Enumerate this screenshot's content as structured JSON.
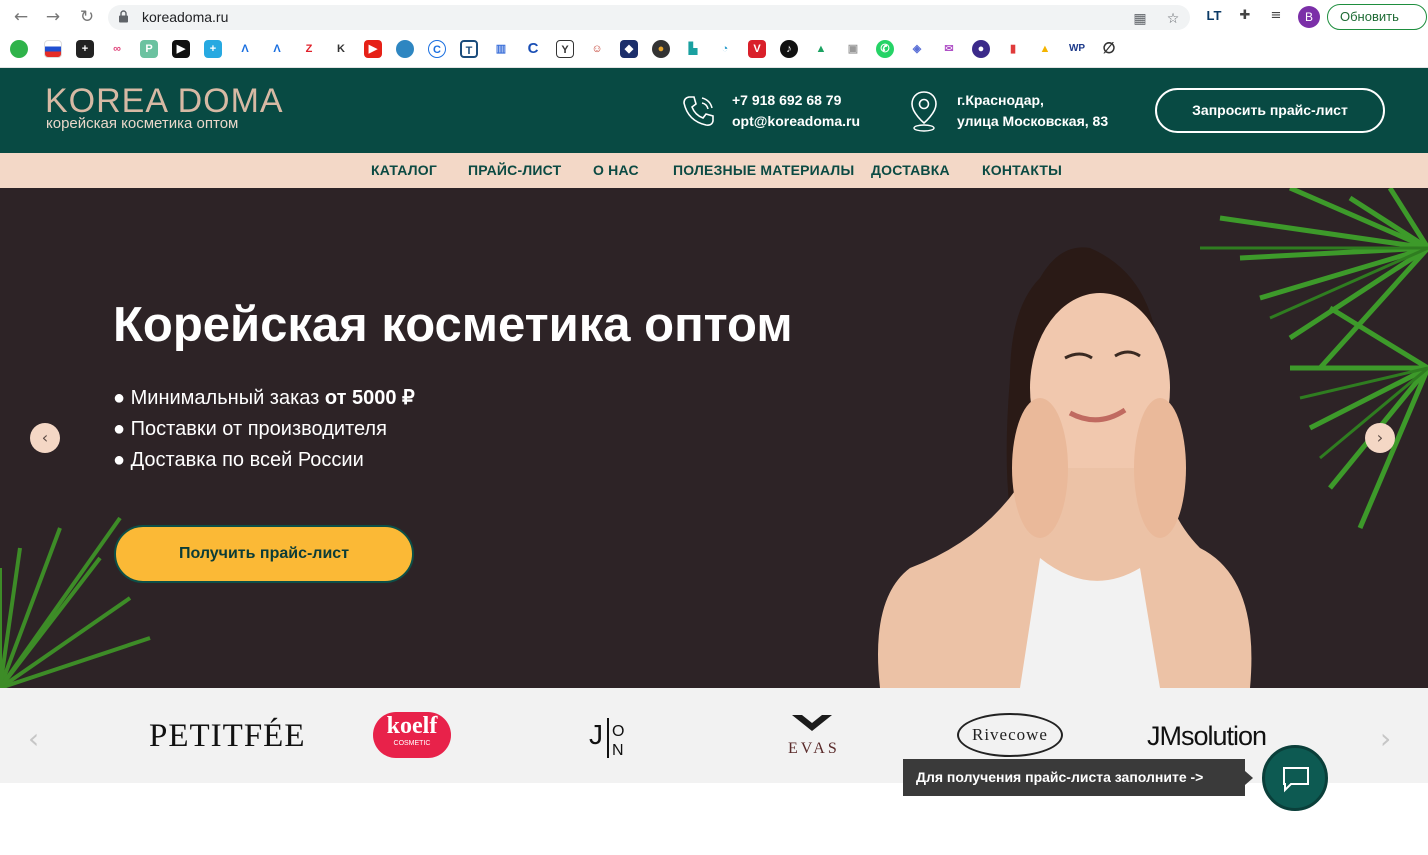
{
  "browser": {
    "url": "koreadoma.ru",
    "profile_initial": "B",
    "update_label": "Обновить"
  },
  "header": {
    "logo_title": "KOREA DOMA",
    "logo_subtitle": "корейская косметика оптом",
    "phone": "+7 918 692 68 79",
    "email": "opt@koreadoma.ru",
    "address_line1": "г.Краснодар,",
    "address_line2": "улица Московская, 83",
    "price_button": "Запросить прайс-лист"
  },
  "menu": [
    {
      "label": "КАТАЛОГ"
    },
    {
      "label": "ПРАЙС-ЛИСТ"
    },
    {
      "label": "О НАС"
    },
    {
      "label": "ПОЛЕЗНЫЕ МАТЕРИАЛЫ"
    },
    {
      "label": "ДОСТАВКА"
    },
    {
      "label": "КОНТАКТЫ"
    }
  ],
  "hero": {
    "title": "Корейская косметика оптом",
    "bullet1_prefix": "● Минимальный заказ ",
    "bullet1_bold": "от 5000 ₽",
    "bullet2": "● Поставки от производителя",
    "bullet3": "● Доставка по всей России",
    "cta": "Получить прайс-лист"
  },
  "brands": [
    {
      "name": "PETITFÉE"
    },
    {
      "name": "koelf",
      "sub": "COSMETIC"
    },
    {
      "name": "J:ON"
    },
    {
      "name": "EVAS"
    },
    {
      "name": "Rivecowe"
    },
    {
      "name": "JMsolution"
    }
  ],
  "chat": {
    "tooltip": "Для получения прайс-листа заполните ->"
  },
  "colors": {
    "header_bg": "#084a43",
    "menu_bg": "#f3d8c7",
    "hero_bg": "#2d2326",
    "cta_bg": "#fbb936",
    "accent_text": "#d7b9a4"
  }
}
